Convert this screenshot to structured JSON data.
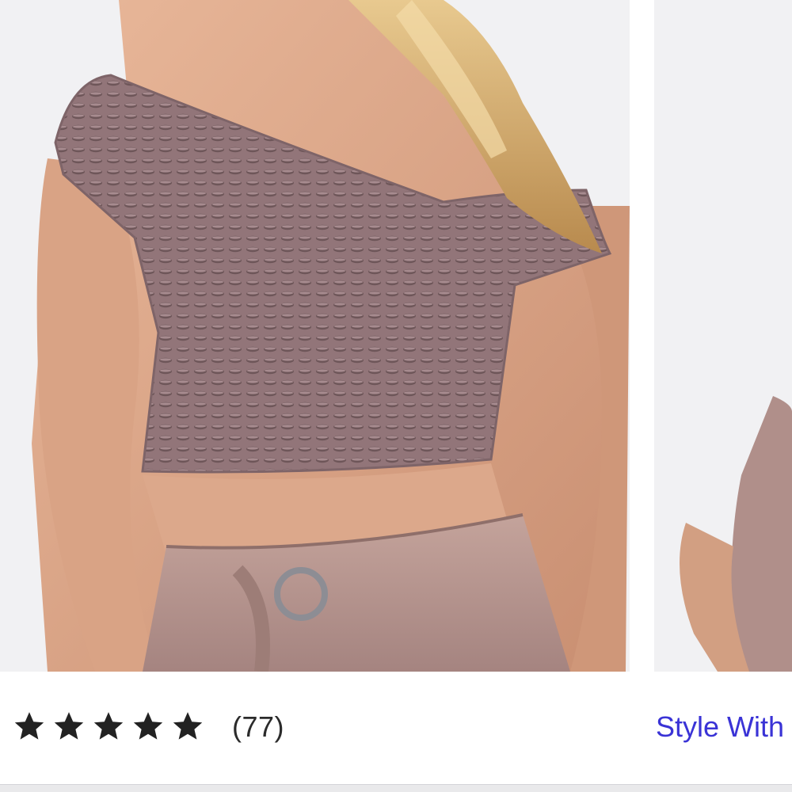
{
  "gallery": {
    "images": [
      {
        "icon": "product-photo-off-shoulder-crop-top"
      },
      {
        "icon": "product-photo-partial-next"
      }
    ]
  },
  "reviews": {
    "stars_filled": 5,
    "stars_total": 5,
    "count_label": "(77)"
  },
  "style_with": {
    "label": "Style With"
  },
  "colors": {
    "star": "#222222",
    "link": "#3a33d6",
    "top_fabric": "#8f7478",
    "pants_fabric": "#b8968f"
  }
}
